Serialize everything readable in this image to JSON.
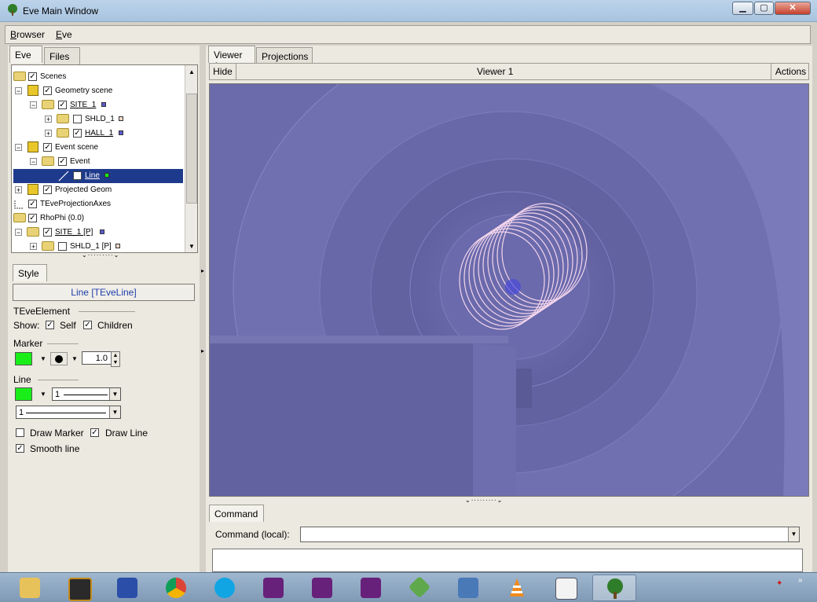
{
  "window": {
    "title": "Eve Main Window"
  },
  "menu": {
    "browser_first": "B",
    "browser_rest": "rowser",
    "eve_first": "E",
    "eve_rest": "ve"
  },
  "left_tabs": {
    "eve": "Eve",
    "files": "Files"
  },
  "tree": {
    "rows": [
      {
        "label": "Scenes"
      },
      {
        "label": "Geometry scene"
      },
      {
        "label": "SITE_1"
      },
      {
        "label": "SHLD_1"
      },
      {
        "label": "HALL_1"
      },
      {
        "label": "Event scene"
      },
      {
        "label": "Event"
      },
      {
        "label": "Line"
      },
      {
        "label": "Projected Geom"
      },
      {
        "label": "TEveProjectionAxes"
      },
      {
        "label": "RhoPhi (0.0)"
      },
      {
        "label": "SITE_1 [P]"
      },
      {
        "label": "SHLD_1 [P]"
      }
    ]
  },
  "style_panel": {
    "tab": "Style",
    "header": "Line [TEveLine]",
    "element_label": "TEveElement",
    "show_label": "Show:",
    "self_label": "Self",
    "children_label": "Children",
    "marker_label": "Marker",
    "marker_size": "1.0",
    "line_label": "Line",
    "line_width": "1",
    "line_style": "1",
    "draw_marker_label": "Draw Marker",
    "draw_line_label": "Draw Line",
    "smooth_line_label": "Smooth line",
    "marker_color": "#19ee19",
    "line_color": "#19ee19"
  },
  "right_tabs": {
    "viewer1": "Viewer 1",
    "projections": "Projections"
  },
  "viewer_bar": {
    "hide": "Hide",
    "title": "Viewer 1",
    "actions": "Actions"
  },
  "command": {
    "tab": "Command",
    "local_label": "Command (local):",
    "input_value": ""
  },
  "taskbar": {
    "icons": [
      "explorer-icon",
      "terminal-icon",
      "save-icon",
      "chrome-icon",
      "skype-icon",
      "visual-studio-icon",
      "visual-studio-icon",
      "visual-studio-icon",
      "network-icon",
      "remote-desktop-icon",
      "vlc-icon",
      "browser-window-icon",
      "eve-tree-icon"
    ]
  }
}
